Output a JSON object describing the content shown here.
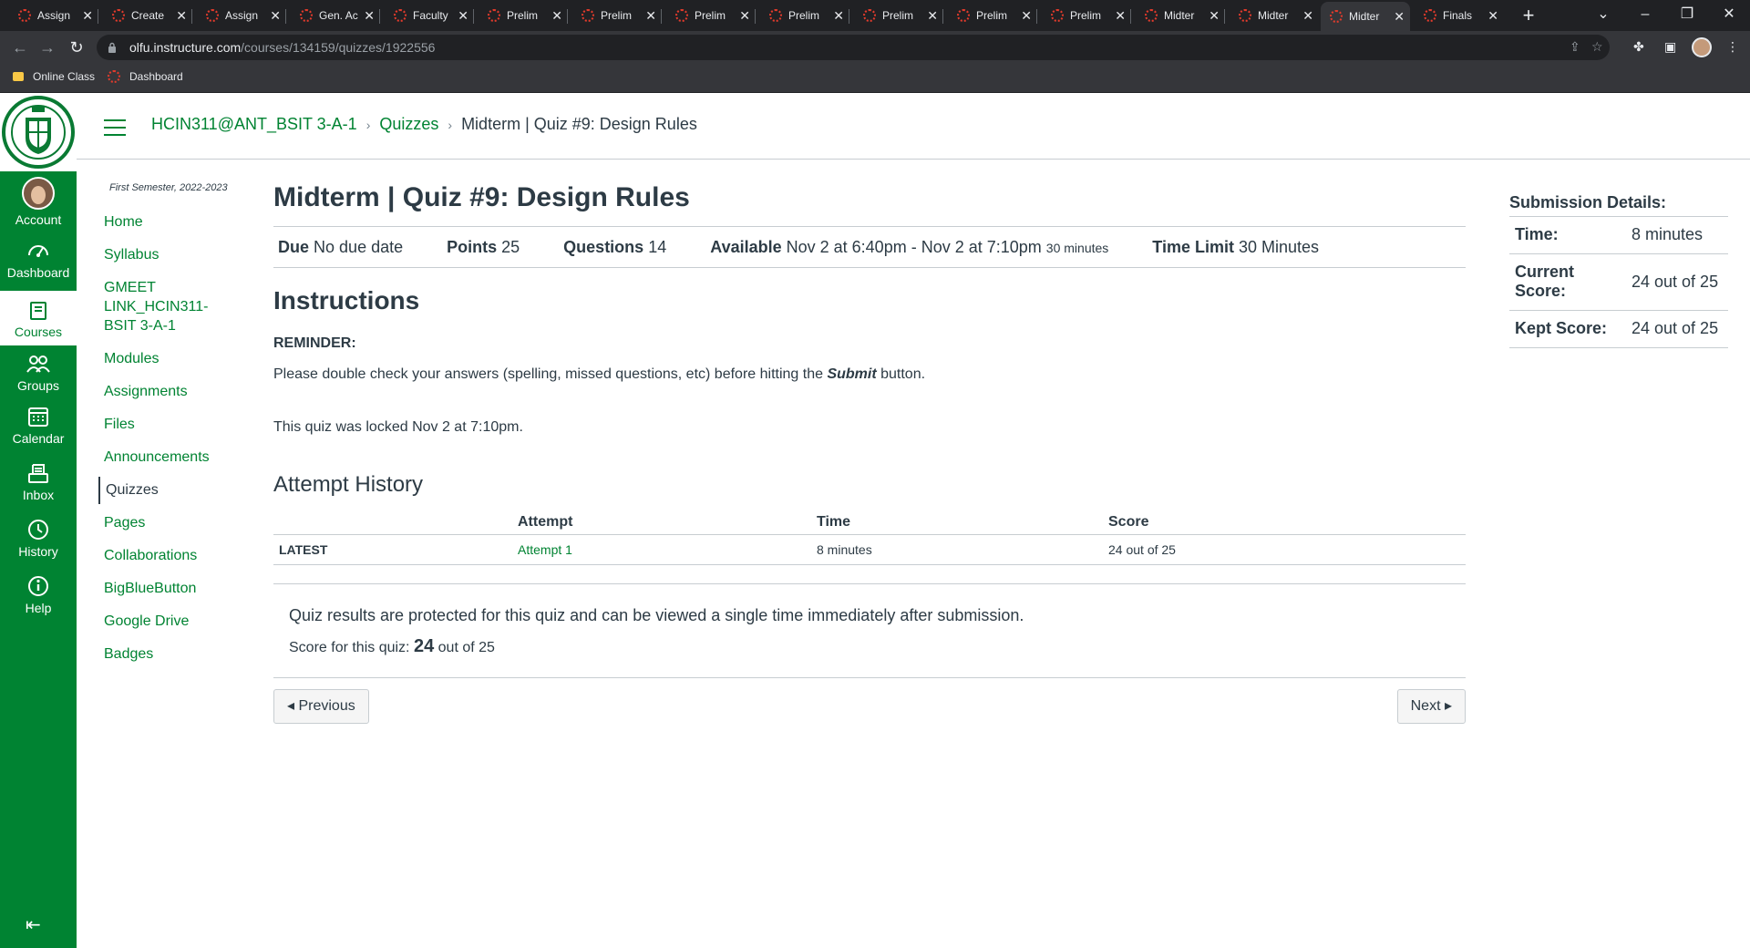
{
  "browser": {
    "tabs": [
      {
        "title": "Assign"
      },
      {
        "title": "Create"
      },
      {
        "title": "Assign"
      },
      {
        "title": "Gen. Ac"
      },
      {
        "title": "Faculty"
      },
      {
        "title": "Prelim"
      },
      {
        "title": "Prelim"
      },
      {
        "title": "Prelim"
      },
      {
        "title": "Prelim"
      },
      {
        "title": "Prelim"
      },
      {
        "title": "Prelim"
      },
      {
        "title": "Prelim"
      },
      {
        "title": "Midter"
      },
      {
        "title": "Midter"
      },
      {
        "title": "Midter"
      },
      {
        "title": "Finals"
      }
    ],
    "active_tab_index": 14,
    "url_host": "olfu.instructure.com",
    "url_path": "/courses/134159/quizzes/1922556",
    "bookmarks": [
      {
        "label": "Online Class"
      },
      {
        "label": "Dashboard"
      }
    ]
  },
  "global_nav": {
    "items": [
      {
        "label": "Account"
      },
      {
        "label": "Dashboard"
      },
      {
        "label": "Courses"
      },
      {
        "label": "Groups"
      },
      {
        "label": "Calendar"
      },
      {
        "label": "Inbox"
      },
      {
        "label": "History"
      },
      {
        "label": "Help"
      }
    ],
    "active": "Courses"
  },
  "breadcrumb": {
    "course": "HCIN311@ANT_BSIT 3-A-1",
    "section": "Quizzes",
    "current": "Midterm | Quiz #9: Design Rules"
  },
  "course_nav": {
    "term": "First Semester, 2022-2023",
    "items": [
      {
        "label": "Home"
      },
      {
        "label": "Syllabus"
      },
      {
        "label": "GMEET LINK_HCIN311-BSIT 3-A-1"
      },
      {
        "label": "Modules"
      },
      {
        "label": "Assignments"
      },
      {
        "label": "Files"
      },
      {
        "label": "Announcements"
      },
      {
        "label": "Quizzes"
      },
      {
        "label": "Pages"
      },
      {
        "label": "Collaborations"
      },
      {
        "label": "BigBlueButton"
      },
      {
        "label": "Google Drive"
      },
      {
        "label": "Badges"
      }
    ],
    "active": "Quizzes"
  },
  "quiz": {
    "title": "Midterm | Quiz #9: Design Rules",
    "due_label": "Due",
    "due_value": "No due date",
    "points_label": "Points",
    "points_value": "25",
    "questions_label": "Questions",
    "questions_value": "14",
    "available_label": "Available",
    "available_value": "Nov 2 at 6:40pm - Nov 2 at 7:10pm",
    "available_duration": "30 minutes",
    "time_limit_label": "Time Limit",
    "time_limit_value": "30 Minutes",
    "instructions_heading": "Instructions",
    "reminder": "REMINDER:",
    "instruction_pre": "Please double check your answers (spelling, missed questions, etc) before hitting the ",
    "instruction_em": "Submit",
    "instruction_post": " button.",
    "locked_text": "This quiz was locked Nov 2 at 7:10pm."
  },
  "attempt_history": {
    "heading": "Attempt History",
    "columns": [
      "",
      "Attempt",
      "Time",
      "Score"
    ],
    "rows": [
      {
        "tag": "LATEST",
        "attempt": "Attempt 1",
        "time": "8 minutes",
        "score": "24 out of 25"
      }
    ]
  },
  "results": {
    "message": "Quiz results are protected for this quiz and can be viewed a single time immediately after submission.",
    "score_prefix": "Score for this quiz: ",
    "score_value": "24",
    "score_suffix": " out of 25"
  },
  "pager": {
    "previous": "◂ Previous",
    "next": "Next ▸"
  },
  "submission": {
    "heading": "Submission Details:",
    "rows": [
      {
        "label": "Time:",
        "value": "8 minutes"
      },
      {
        "label": "Current Score:",
        "value": "24 out of 25"
      },
      {
        "label": "Kept Score:",
        "value": "24 out of 25"
      }
    ]
  },
  "colors": {
    "brand": "#008332",
    "text": "#2d3b45",
    "border": "#c7cdd1"
  }
}
